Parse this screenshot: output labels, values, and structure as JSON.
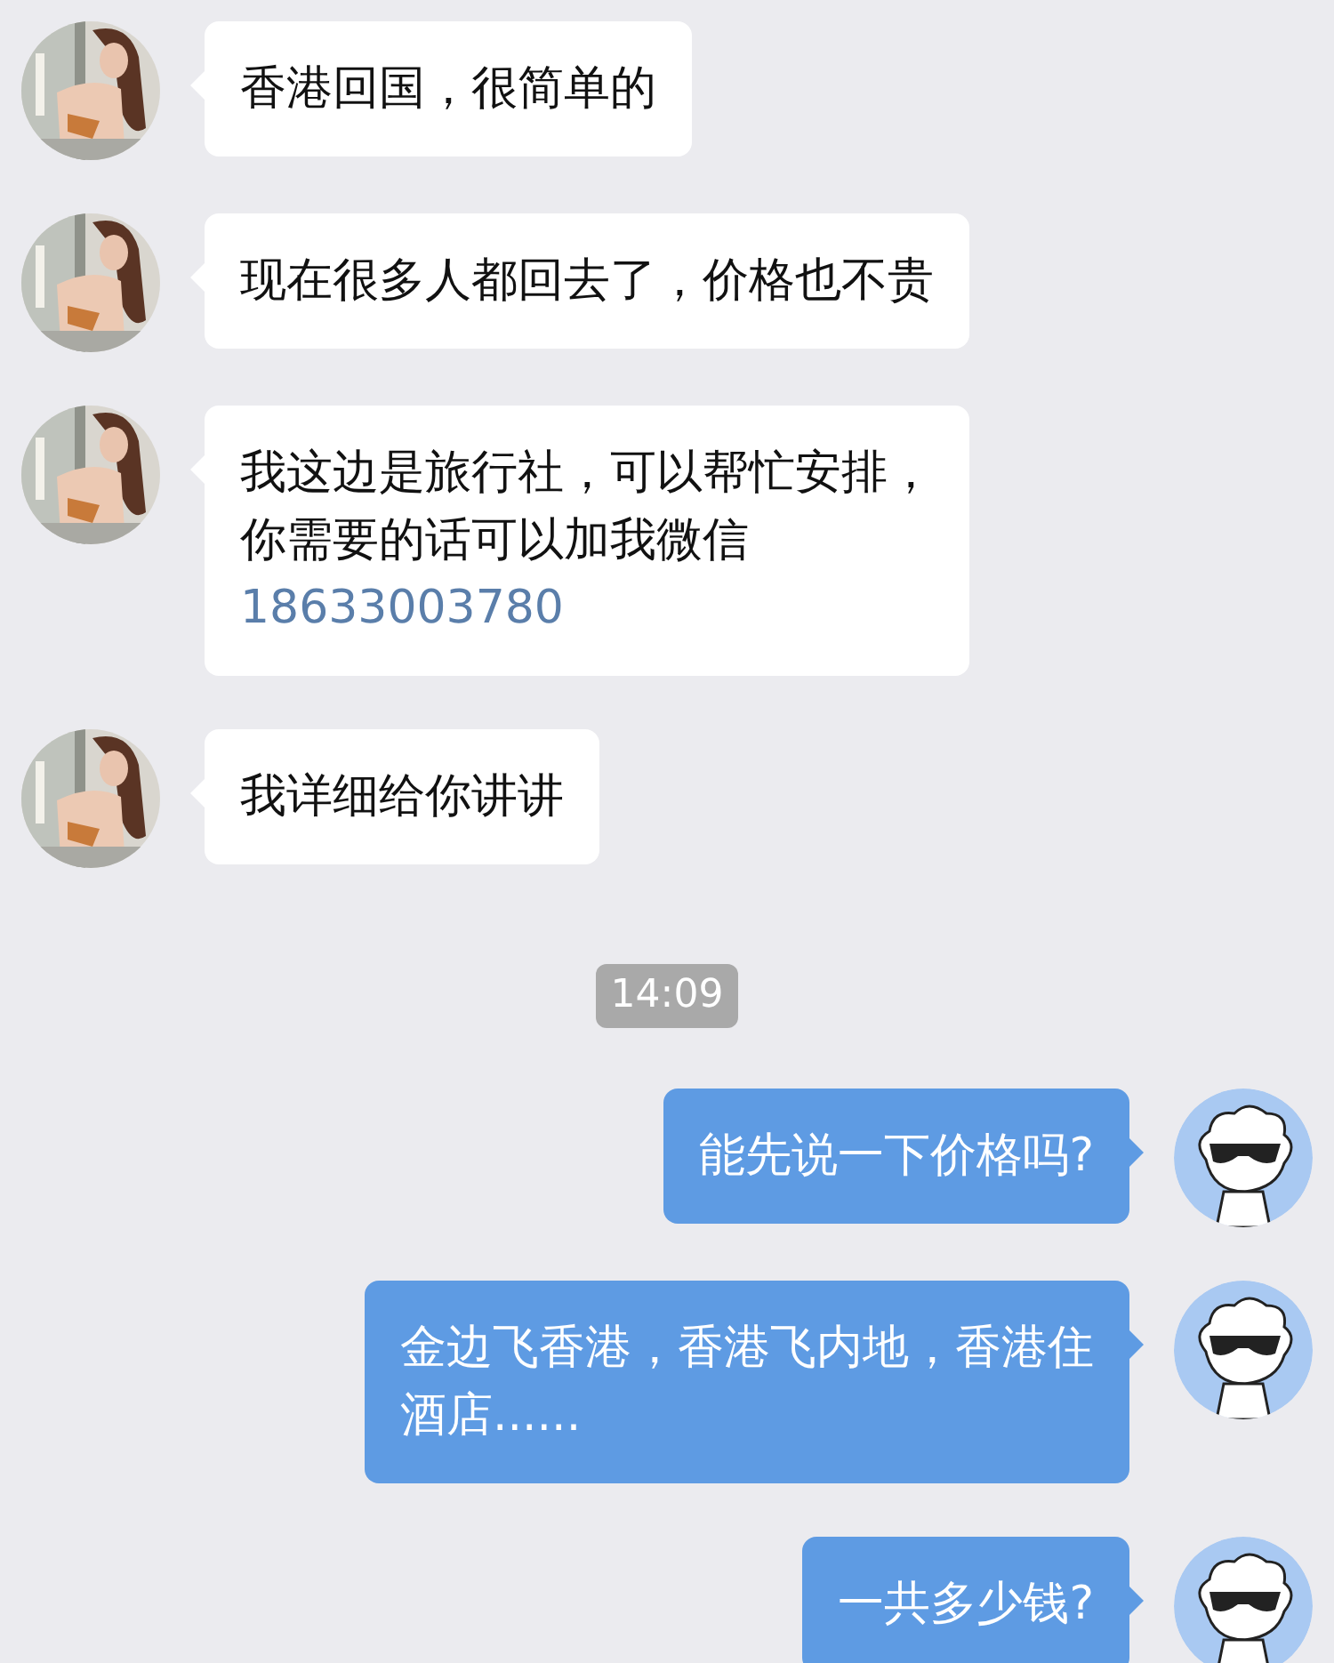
{
  "messages": [
    {
      "kind": "text",
      "from_me": false,
      "lines": [
        "香港回国，很简单的"
      ]
    },
    {
      "kind": "text",
      "from_me": false,
      "lines": [
        "现在很多人都回去了，价格也不贵"
      ]
    },
    {
      "kind": "text",
      "from_me": false,
      "lines": [
        "我这边是旅行社，可以帮忙安排，",
        "你需要的话可以加我微信"
      ],
      "link": "18633003780"
    },
    {
      "kind": "text",
      "from_me": false,
      "lines": [
        "我详细给你讲讲"
      ]
    },
    {
      "kind": "time",
      "text": "14:09"
    },
    {
      "kind": "text",
      "from_me": true,
      "lines": [
        "能先说一下价格吗?"
      ]
    },
    {
      "kind": "text",
      "from_me": true,
      "lines": [
        "金边飞香港，香港飞内地，香港住",
        "酒店......"
      ]
    },
    {
      "kind": "text",
      "from_me": true,
      "lines": [
        "一共多少钱?"
      ]
    }
  ]
}
